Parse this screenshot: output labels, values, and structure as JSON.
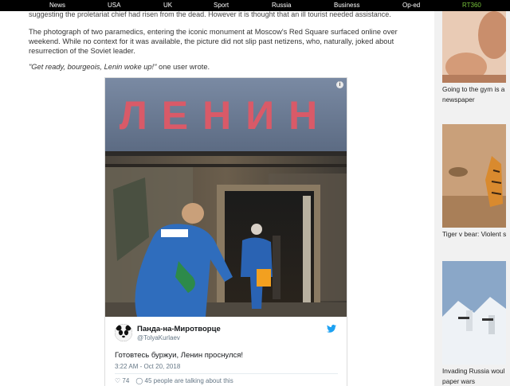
{
  "nav": {
    "items": [
      {
        "label": "News"
      },
      {
        "label": "USA"
      },
      {
        "label": "UK"
      },
      {
        "label": "Sport"
      },
      {
        "label": "Russia"
      },
      {
        "label": "Business"
      },
      {
        "label": "Op-ed"
      },
      {
        "label": "RT360"
      }
    ],
    "accent_color": "#77c23b"
  },
  "article": {
    "cut_line": "suggesting the proletariat chief had risen from the dead. However it is thought that an ill tourist needed assistance.",
    "para1": "The photograph of two paramedics, entering the iconic monument at Moscow's Red Square surfaced online over weekend. While no context for it was available, the picture did not slip past netizens, who, naturally, joked about resurrection of the Soviet leader.",
    "quote_italic": "\"Get ready, bourgeois, Lenin woke up!\"",
    "quote_rest": " one user wrote."
  },
  "tweet": {
    "photo_sign": "ЛЕНИН",
    "info_icon": "i",
    "display_name": "Панда-на-Миротворце",
    "handle": "@TolyaKurlaev",
    "text": "Готовтесь буржуи, Ленин проснулся!",
    "timestamp": "3:22 AM - Oct 20, 2018",
    "likes": "74",
    "people_talking": "45 people are talking about this",
    "bird_color": "#1da1f2"
  },
  "sidebar": {
    "cards": [
      {
        "caption_line1": "Going to the gym is a",
        "caption_line2": "newspaper"
      },
      {
        "caption_line1": "Tiger v bear: Violent s",
        "caption_line2": ""
      },
      {
        "caption_line1": "Invading Russia woul",
        "caption_line2": "paper wars"
      }
    ]
  }
}
